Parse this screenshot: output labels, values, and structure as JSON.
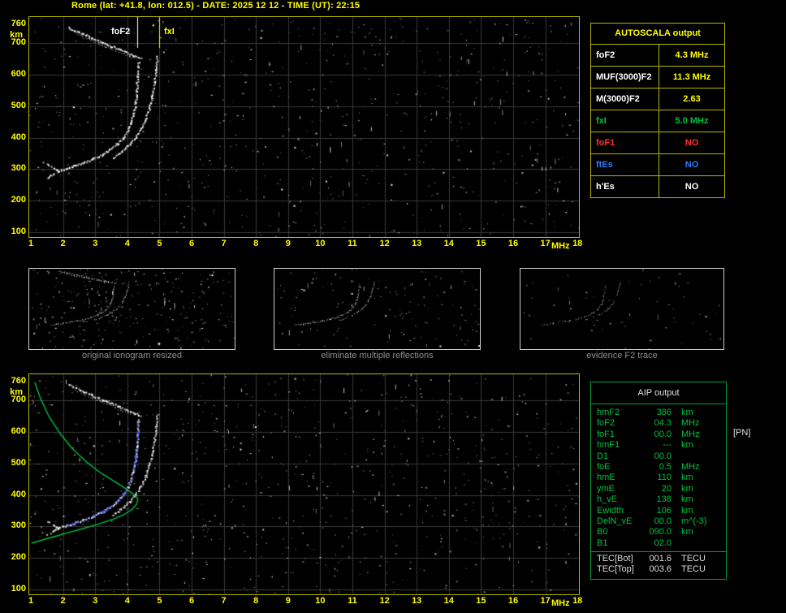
{
  "title": "Rome (lat: +41.8, lon: 012.5) - DATE: 2025 12 12 - TIME (UT): 22:15",
  "colors": {
    "yellow": "#ffff00",
    "green": "#00c040",
    "red": "#ff3232",
    "blue": "#2e7cff",
    "white": "#ffffff",
    "grid": "#3a3a3a"
  },
  "axes": {
    "x_ticks": [
      "1",
      "2",
      "3",
      "4",
      "5",
      "6",
      "7",
      "8",
      "9",
      "10",
      "11",
      "12",
      "13",
      "14",
      "15",
      "16",
      "17",
      "18"
    ],
    "x_unit": "MHz",
    "y_ticks": [
      "760",
      "700",
      "600",
      "500",
      "400",
      "300",
      "200",
      "100"
    ],
    "y_unit": "km"
  },
  "top_plot": {
    "foF2_label": "foF2",
    "fxI_label": "fxI"
  },
  "autoscala": {
    "header": "AUTOSCALA output",
    "rows": [
      {
        "param": "foF2",
        "value": "4.3 MHz",
        "param_color": "#ffffff",
        "value_color": "#ffff00"
      },
      {
        "param": "MUF(3000)F2",
        "value": "11.3 MHz",
        "param_color": "#ffffff",
        "value_color": "#ffff00"
      },
      {
        "param": "M(3000)F2",
        "value": "2.63",
        "param_color": "#ffffff",
        "value_color": "#ffff00"
      },
      {
        "param": "fxI",
        "value": "5.0 MHz",
        "param_color": "#00c040",
        "value_color": "#00c040"
      },
      {
        "param": "foF1",
        "value": "NO",
        "param_color": "#ff3232",
        "value_color": "#ff3232"
      },
      {
        "param": "ftEs",
        "value": "NO",
        "param_color": "#2e7cff",
        "value_color": "#2e7cff"
      },
      {
        "param": "h'Es",
        "value": "NO",
        "param_color": "#ffffff",
        "value_color": "#ffffff"
      }
    ]
  },
  "thumbnails": [
    {
      "caption": "original ionogram resized"
    },
    {
      "caption": "eliminate multiple reflections"
    },
    {
      "caption": "evidence F2 trace"
    }
  ],
  "aip": {
    "header": "AIP output",
    "pn_note": "[PN]",
    "rows": [
      {
        "param": "hmF2",
        "value": "386",
        "unit": "km"
      },
      {
        "param": "foF2",
        "value": "04.3",
        "unit": "MHz"
      },
      {
        "param": "foF1",
        "value": "00.0",
        "unit": "MHz"
      },
      {
        "param": "hmF1",
        "value": "---",
        "unit": "km"
      },
      {
        "param": "D1",
        "value": "00.0",
        "unit": ""
      },
      {
        "param": "foE",
        "value": "0.5",
        "unit": "MHz"
      },
      {
        "param": "hmE",
        "value": "110",
        "unit": "km"
      },
      {
        "param": "ymE",
        "value": "20",
        "unit": "km"
      },
      {
        "param": "h_vE",
        "value": "138",
        "unit": "km"
      },
      {
        "param": "Ewidth",
        "value": "106",
        "unit": "km"
      },
      {
        "param": "DelN_vE",
        "value": "00.0",
        "unit": "m^(-3)"
      },
      {
        "param": "B0",
        "value": "090.0",
        "unit": "km"
      },
      {
        "param": "B1",
        "value": "02.0",
        "unit": ""
      },
      {
        "param": "TEC[Bot]",
        "value": "001.6",
        "unit": "TECU",
        "color": "#dcdcdc",
        "sep": true
      },
      {
        "param": "TEC[Top]",
        "value": "003.6",
        "unit": "TECU",
        "color": "#dcdcdc"
      }
    ]
  },
  "chart_data": {
    "type": "scatter",
    "x_range_MHz": [
      1,
      18
    ],
    "y_range_km": [
      90,
      770
    ],
    "x_unit": "MHz",
    "y_unit": "km",
    "foF2_MHz": 4.3,
    "fxI_MHz": 5.0,
    "MUF3000F2_MHz": 11.3,
    "M3000F2": 2.63,
    "hmF2_km": 386,
    "grid": true,
    "traces": {
      "f2_ordinary": [
        [
          1.85,
          296
        ],
        [
          2.05,
          303
        ],
        [
          2.3,
          311
        ],
        [
          2.6,
          321
        ],
        [
          2.9,
          333
        ],
        [
          3.2,
          347
        ],
        [
          3.45,
          363
        ],
        [
          3.65,
          380
        ],
        [
          3.85,
          401
        ],
        [
          4.0,
          424
        ],
        [
          4.1,
          449
        ],
        [
          4.18,
          478
        ],
        [
          4.24,
          512
        ],
        [
          4.28,
          552
        ],
        [
          4.31,
          597
        ],
        [
          4.33,
          642
        ]
      ],
      "f2_extraordinary": [
        [
          3.55,
          338
        ],
        [
          3.8,
          357
        ],
        [
          4.05,
          380
        ],
        [
          4.25,
          404
        ],
        [
          4.42,
          431
        ],
        [
          4.56,
          461
        ],
        [
          4.67,
          496
        ],
        [
          4.76,
          534
        ],
        [
          4.83,
          577
        ],
        [
          4.88,
          620
        ],
        [
          4.91,
          658
        ]
      ],
      "second_hop_a": [
        [
          2.15,
          752
        ],
        [
          2.5,
          736
        ],
        [
          2.9,
          718
        ],
        [
          3.3,
          700
        ],
        [
          3.7,
          683
        ],
        [
          4.1,
          666
        ],
        [
          4.4,
          652
        ]
      ],
      "second_hop_b": [
        [
          2.35,
          733
        ],
        [
          2.75,
          716
        ],
        [
          3.15,
          698
        ],
        [
          3.55,
          681
        ],
        [
          3.9,
          666
        ],
        [
          4.2,
          653
        ]
      ],
      "arrow_artifact": [
        [
          1.5,
          318
        ],
        [
          1.68,
          306
        ],
        [
          1.85,
          296
        ],
        [
          1.68,
          286
        ],
        [
          1.5,
          276
        ]
      ],
      "profile": [
        [
          1.12,
          758
        ],
        [
          1.3,
          706
        ],
        [
          1.55,
          652
        ],
        [
          1.9,
          596
        ],
        [
          2.3,
          546
        ],
        [
          2.75,
          503
        ],
        [
          3.2,
          468
        ],
        [
          3.65,
          440
        ],
        [
          3.95,
          420
        ],
        [
          4.18,
          403
        ],
        [
          4.3,
          392
        ],
        [
          4.33,
          386
        ],
        [
          4.29,
          371
        ],
        [
          4.16,
          355
        ],
        [
          3.92,
          339
        ],
        [
          3.58,
          324
        ],
        [
          3.15,
          309
        ],
        [
          2.65,
          294
        ],
        [
          2.15,
          280
        ],
        [
          1.7,
          267
        ],
        [
          1.32,
          256
        ],
        [
          1.02,
          247
        ]
      ]
    },
    "seeds": {
      "top": 987123,
      "bottom": 424242,
      "thumb1": 101,
      "thumb2": 202,
      "thumb3": 303
    }
  }
}
